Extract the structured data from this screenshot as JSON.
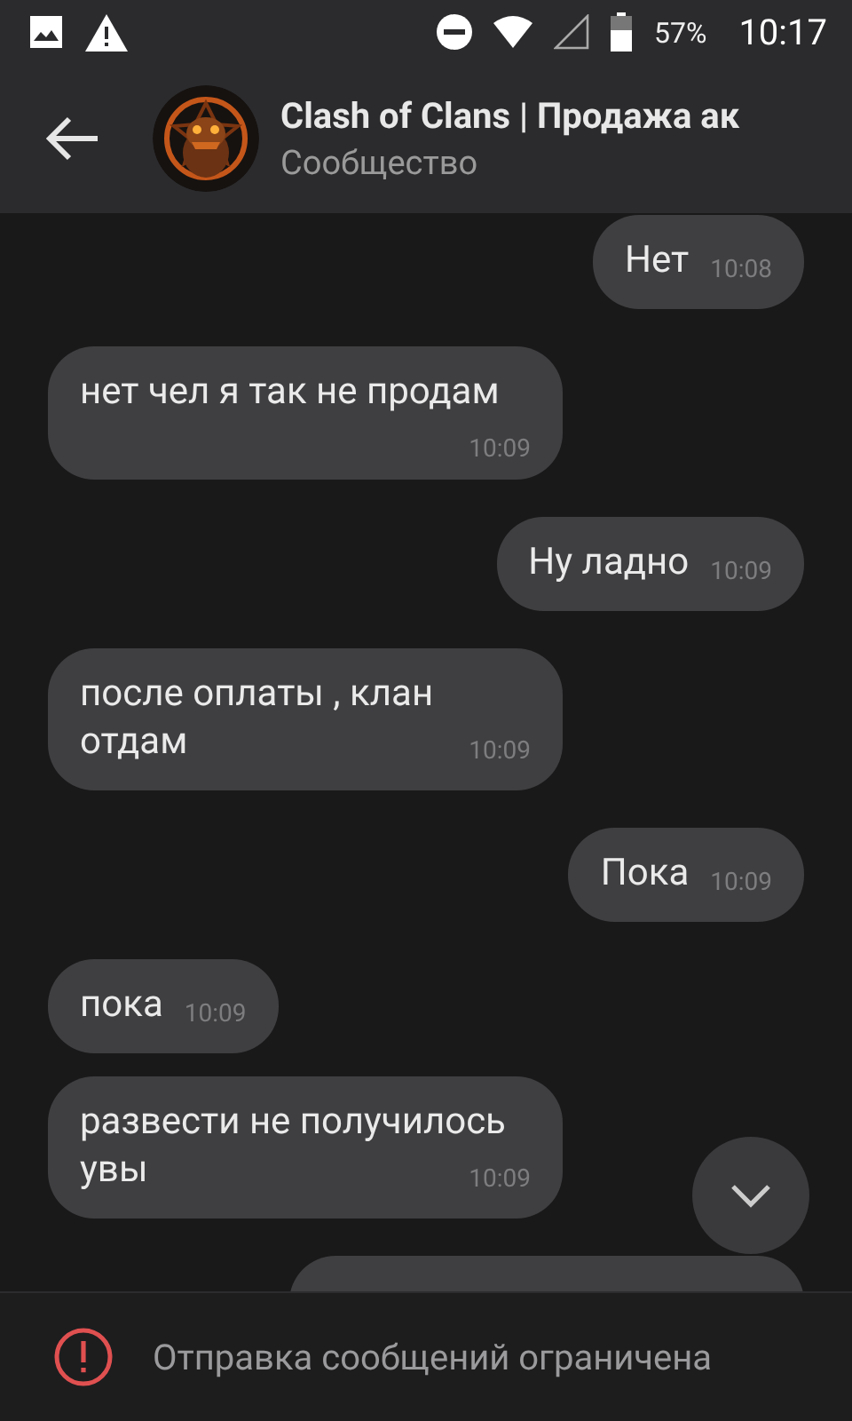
{
  "status_bar": {
    "battery": "57%",
    "time": "10:17"
  },
  "header": {
    "title": "Clash of Clans | Продажа ак",
    "subtitle": "Сообщество"
  },
  "messages": [
    {
      "outgoing": true,
      "text": "Нет",
      "time": "10:08"
    },
    {
      "outgoing": false,
      "text": "нет чел я так не продам",
      "time": "10:09"
    },
    {
      "outgoing": true,
      "text": "Ну ладно",
      "time": "10:09"
    },
    {
      "outgoing": false,
      "text": "после оплаты , клан отдам",
      "time": "10:09"
    },
    {
      "outgoing": true,
      "text": "Пока",
      "time": "10:09"
    },
    {
      "outgoing": false,
      "text": "пока",
      "time": "10:09"
    },
    {
      "outgoing": false,
      "text": "развести не получилось увы",
      "time": "10:09"
    },
    {
      "outgoing": true
    }
  ],
  "notice": "Отправка сообщений ограничена"
}
